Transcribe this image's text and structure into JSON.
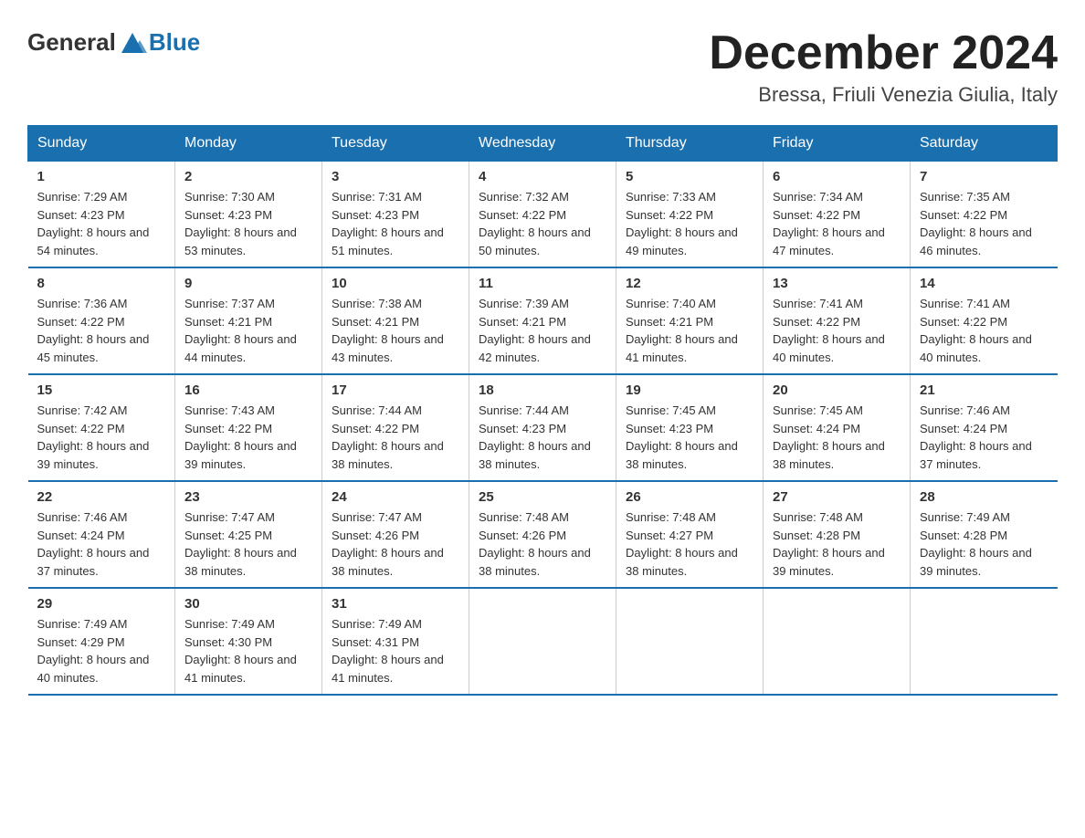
{
  "header": {
    "logo_general": "General",
    "logo_blue": "Blue",
    "month_title": "December 2024",
    "location": "Bressa, Friuli Venezia Giulia, Italy"
  },
  "days_of_week": [
    "Sunday",
    "Monday",
    "Tuesday",
    "Wednesday",
    "Thursday",
    "Friday",
    "Saturday"
  ],
  "weeks": [
    [
      {
        "day": "1",
        "sunrise": "7:29 AM",
        "sunset": "4:23 PM",
        "daylight": "8 hours and 54 minutes."
      },
      {
        "day": "2",
        "sunrise": "7:30 AM",
        "sunset": "4:23 PM",
        "daylight": "8 hours and 53 minutes."
      },
      {
        "day": "3",
        "sunrise": "7:31 AM",
        "sunset": "4:23 PM",
        "daylight": "8 hours and 51 minutes."
      },
      {
        "day": "4",
        "sunrise": "7:32 AM",
        "sunset": "4:22 PM",
        "daylight": "8 hours and 50 minutes."
      },
      {
        "day": "5",
        "sunrise": "7:33 AM",
        "sunset": "4:22 PM",
        "daylight": "8 hours and 49 minutes."
      },
      {
        "day": "6",
        "sunrise": "7:34 AM",
        "sunset": "4:22 PM",
        "daylight": "8 hours and 47 minutes."
      },
      {
        "day": "7",
        "sunrise": "7:35 AM",
        "sunset": "4:22 PM",
        "daylight": "8 hours and 46 minutes."
      }
    ],
    [
      {
        "day": "8",
        "sunrise": "7:36 AM",
        "sunset": "4:22 PM",
        "daylight": "8 hours and 45 minutes."
      },
      {
        "day": "9",
        "sunrise": "7:37 AM",
        "sunset": "4:21 PM",
        "daylight": "8 hours and 44 minutes."
      },
      {
        "day": "10",
        "sunrise": "7:38 AM",
        "sunset": "4:21 PM",
        "daylight": "8 hours and 43 minutes."
      },
      {
        "day": "11",
        "sunrise": "7:39 AM",
        "sunset": "4:21 PM",
        "daylight": "8 hours and 42 minutes."
      },
      {
        "day": "12",
        "sunrise": "7:40 AM",
        "sunset": "4:21 PM",
        "daylight": "8 hours and 41 minutes."
      },
      {
        "day": "13",
        "sunrise": "7:41 AM",
        "sunset": "4:22 PM",
        "daylight": "8 hours and 40 minutes."
      },
      {
        "day": "14",
        "sunrise": "7:41 AM",
        "sunset": "4:22 PM",
        "daylight": "8 hours and 40 minutes."
      }
    ],
    [
      {
        "day": "15",
        "sunrise": "7:42 AM",
        "sunset": "4:22 PM",
        "daylight": "8 hours and 39 minutes."
      },
      {
        "day": "16",
        "sunrise": "7:43 AM",
        "sunset": "4:22 PM",
        "daylight": "8 hours and 39 minutes."
      },
      {
        "day": "17",
        "sunrise": "7:44 AM",
        "sunset": "4:22 PM",
        "daylight": "8 hours and 38 minutes."
      },
      {
        "day": "18",
        "sunrise": "7:44 AM",
        "sunset": "4:23 PM",
        "daylight": "8 hours and 38 minutes."
      },
      {
        "day": "19",
        "sunrise": "7:45 AM",
        "sunset": "4:23 PM",
        "daylight": "8 hours and 38 minutes."
      },
      {
        "day": "20",
        "sunrise": "7:45 AM",
        "sunset": "4:24 PM",
        "daylight": "8 hours and 38 minutes."
      },
      {
        "day": "21",
        "sunrise": "7:46 AM",
        "sunset": "4:24 PM",
        "daylight": "8 hours and 37 minutes."
      }
    ],
    [
      {
        "day": "22",
        "sunrise": "7:46 AM",
        "sunset": "4:24 PM",
        "daylight": "8 hours and 37 minutes."
      },
      {
        "day": "23",
        "sunrise": "7:47 AM",
        "sunset": "4:25 PM",
        "daylight": "8 hours and 38 minutes."
      },
      {
        "day": "24",
        "sunrise": "7:47 AM",
        "sunset": "4:26 PM",
        "daylight": "8 hours and 38 minutes."
      },
      {
        "day": "25",
        "sunrise": "7:48 AM",
        "sunset": "4:26 PM",
        "daylight": "8 hours and 38 minutes."
      },
      {
        "day": "26",
        "sunrise": "7:48 AM",
        "sunset": "4:27 PM",
        "daylight": "8 hours and 38 minutes."
      },
      {
        "day": "27",
        "sunrise": "7:48 AM",
        "sunset": "4:28 PM",
        "daylight": "8 hours and 39 minutes."
      },
      {
        "day": "28",
        "sunrise": "7:49 AM",
        "sunset": "4:28 PM",
        "daylight": "8 hours and 39 minutes."
      }
    ],
    [
      {
        "day": "29",
        "sunrise": "7:49 AM",
        "sunset": "4:29 PM",
        "daylight": "8 hours and 40 minutes."
      },
      {
        "day": "30",
        "sunrise": "7:49 AM",
        "sunset": "4:30 PM",
        "daylight": "8 hours and 41 minutes."
      },
      {
        "day": "31",
        "sunrise": "7:49 AM",
        "sunset": "4:31 PM",
        "daylight": "8 hours and 41 minutes."
      },
      null,
      null,
      null,
      null
    ]
  ]
}
